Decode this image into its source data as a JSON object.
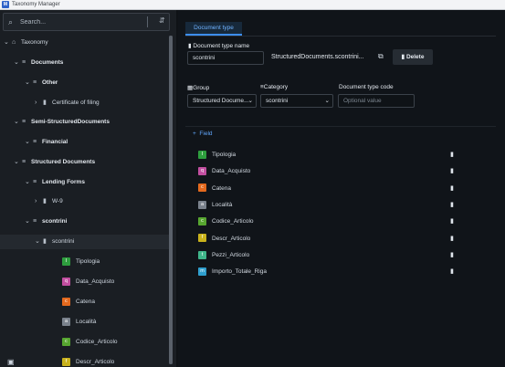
{
  "window": {
    "title": "Taxonomy Manager"
  },
  "search": {
    "placeholder": "Search..."
  },
  "tree": [
    {
      "label": "Taxonomy",
      "level": 0,
      "icon": "folder-icon",
      "bold": false
    },
    {
      "label": "Documents",
      "level": 1,
      "icon": "list-icon",
      "bold": true
    },
    {
      "label": "Other",
      "level": 2,
      "icon": "list-icon",
      "bold": true
    },
    {
      "label": "Certificate of filing",
      "level": 3,
      "icon": "document-icon",
      "bold": false
    },
    {
      "label": "Semi-StructuredDocuments",
      "level": 1,
      "icon": "list-icon",
      "bold": true
    },
    {
      "label": "Financial",
      "level": 2,
      "icon": "list-icon",
      "bold": true
    },
    {
      "label": "Structured Documents",
      "level": 1,
      "icon": "list-icon",
      "bold": true
    },
    {
      "label": "Lending Forms",
      "level": 2,
      "icon": "list-icon",
      "bold": true
    },
    {
      "label": "W-9",
      "level": 3,
      "icon": "document-icon",
      "bold": false
    },
    {
      "label": "scontrini",
      "level": 2,
      "icon": "list-icon",
      "bold": true
    },
    {
      "label": "scontrini",
      "level": 3,
      "icon": "document-icon",
      "bold": false,
      "selected": true
    }
  ],
  "tree_fields": [
    {
      "letter": "I",
      "label": "Tipologia",
      "color": "#2e9e3e"
    },
    {
      "letter": "q",
      "label": "Data_Acquisto",
      "color": "#c24fa0"
    },
    {
      "letter": "c",
      "label": "Catena",
      "color": "#e3691e"
    },
    {
      "letter": "a",
      "label": "Località",
      "color": "#7a828c"
    },
    {
      "letter": "c",
      "label": "Codice_Articolo",
      "color": "#57a630"
    },
    {
      "letter": "f",
      "label": "Descr_Articolo",
      "color": "#c9b21c"
    }
  ],
  "detail": {
    "tab_label": "Document type",
    "name_label": "Document type name",
    "name_value": "scontrini",
    "full_name": "StructuredDocuments.scontrini...",
    "delete_label": "Delete",
    "group_label": "Group",
    "group_value": "Structured Docume...",
    "category_label": "Category",
    "category_value": "scontrini",
    "code_label": "Document type code",
    "code_placeholder": "Optional value",
    "add_field_label": "Field"
  },
  "fields": [
    {
      "letter": "I",
      "label": "Tipologia",
      "color": "#2e9e3e"
    },
    {
      "letter": "q",
      "label": "Data_Acquisto",
      "color": "#c24fa0"
    },
    {
      "letter": "c",
      "label": "Catena",
      "color": "#e3691e"
    },
    {
      "letter": "a",
      "label": "Località",
      "color": "#7a828c"
    },
    {
      "letter": "c",
      "label": "Codice_Articolo",
      "color": "#57a630"
    },
    {
      "letter": "f",
      "label": "Descr_Articolo",
      "color": "#c9b21c"
    },
    {
      "letter": "t",
      "label": "Pezzi_Articolo",
      "color": "#3fb58a"
    },
    {
      "letter": "m",
      "label": "Importo_Totale_Riga",
      "color": "#2f9fce"
    }
  ]
}
